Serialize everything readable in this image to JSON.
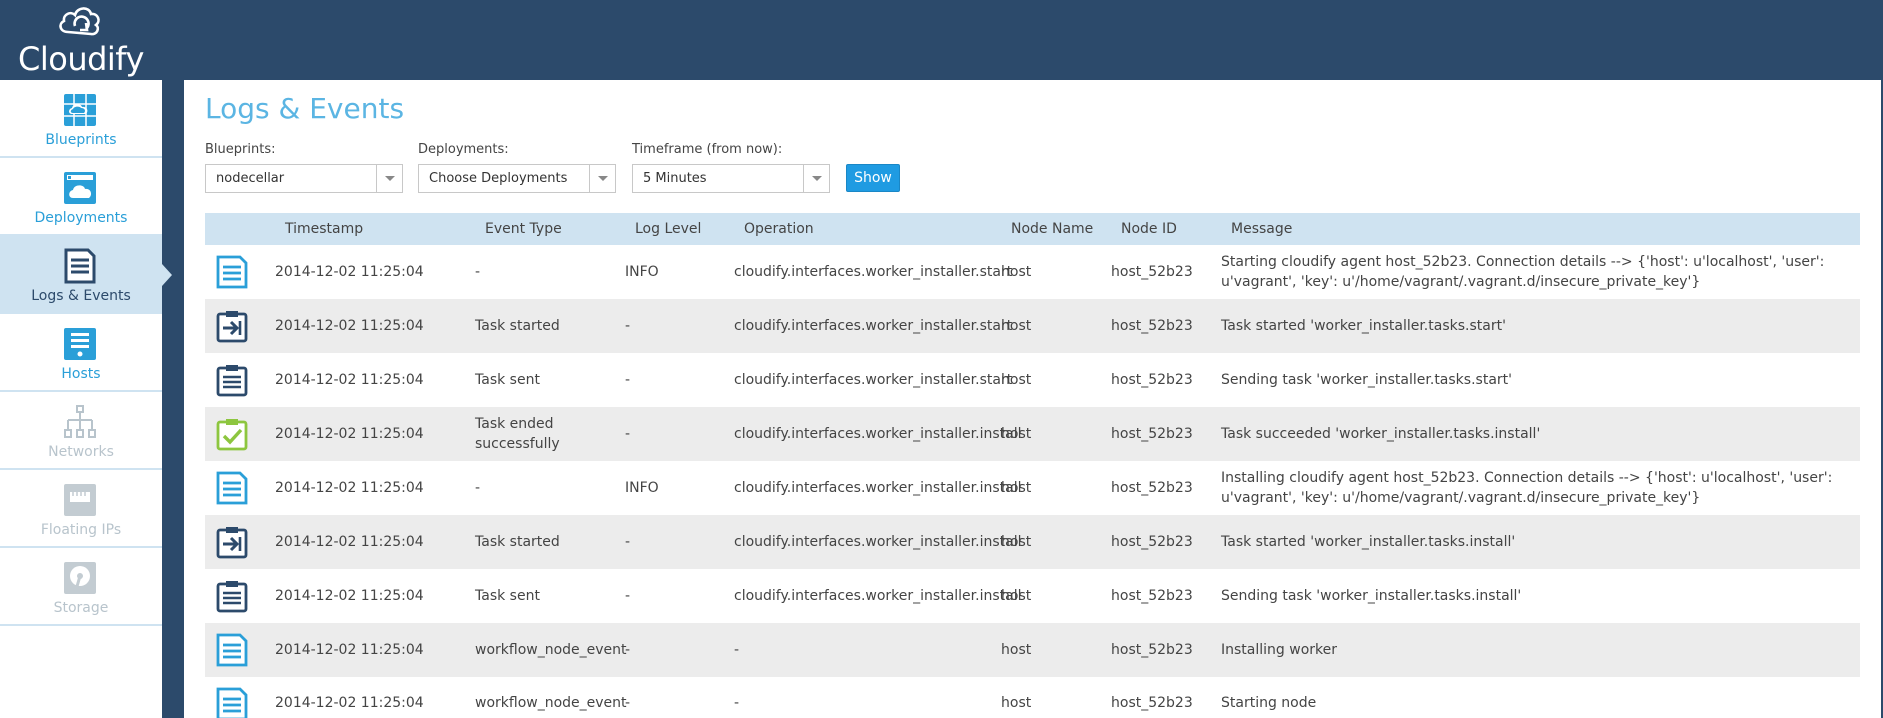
{
  "brand": {
    "name": "Cloudify"
  },
  "sidebar": {
    "items": [
      {
        "label": "Blueprints",
        "icon": "blueprints-icon",
        "state": "normal"
      },
      {
        "label": "Deployments",
        "icon": "deployments-icon",
        "state": "normal"
      },
      {
        "label": "Logs & Events",
        "icon": "logs-events-icon",
        "state": "active"
      },
      {
        "label": "Hosts",
        "icon": "hosts-icon",
        "state": "normal"
      },
      {
        "label": "Networks",
        "icon": "networks-icon",
        "state": "disabled"
      },
      {
        "label": "Floating IPs",
        "icon": "floating-ips-icon",
        "state": "disabled"
      },
      {
        "label": "Storage",
        "icon": "storage-icon",
        "state": "disabled"
      }
    ]
  },
  "page": {
    "title": "Logs & Events"
  },
  "filters": {
    "blueprints": {
      "label": "Blueprints:",
      "value": "nodecellar"
    },
    "deployments": {
      "label": "Deployments:",
      "value": "Choose Deployments"
    },
    "timeframe": {
      "label": "Timeframe (from now):",
      "value": "5 Minutes"
    },
    "show_label": "Show"
  },
  "table": {
    "columns": {
      "timestamp": "Timestamp",
      "event_type": "Event Type",
      "log_level": "Log Level",
      "operation": "Operation",
      "node_name": "Node Name",
      "node_id": "Node ID",
      "message": "Message"
    },
    "rows": [
      {
        "icon": "log-icon",
        "timestamp": "2014-12-02 11:25:04",
        "event_type": "-",
        "log_level": "INFO",
        "operation": "cloudify.interfaces.worker_installer.start",
        "node_name": "host",
        "node_id": "host_52b23",
        "message": "Starting cloudify agent host_52b23. Connection details --> {'host': u'localhost', 'user': u'vagrant', 'key': u'/home/vagrant/.vagrant.d/insecure_private_key'}"
      },
      {
        "icon": "task-started-icon",
        "timestamp": "2014-12-02 11:25:04",
        "event_type": "Task started",
        "log_level": "-",
        "operation": "cloudify.interfaces.worker_installer.start",
        "node_name": "host",
        "node_id": "host_52b23",
        "message": "Task started 'worker_installer.tasks.start'"
      },
      {
        "icon": "task-sent-icon",
        "timestamp": "2014-12-02 11:25:04",
        "event_type": "Task sent",
        "log_level": "-",
        "operation": "cloudify.interfaces.worker_installer.start",
        "node_name": "host",
        "node_id": "host_52b23",
        "message": "Sending task 'worker_installer.tasks.start'"
      },
      {
        "icon": "task-succeeded-icon",
        "timestamp": "2014-12-02 11:25:04",
        "event_type": "Task ended successfully",
        "log_level": "-",
        "operation": "cloudify.interfaces.worker_installer.install",
        "node_name": "host",
        "node_id": "host_52b23",
        "message": "Task succeeded 'worker_installer.tasks.install'"
      },
      {
        "icon": "log-icon",
        "timestamp": "2014-12-02 11:25:04",
        "event_type": "-",
        "log_level": "INFO",
        "operation": "cloudify.interfaces.worker_installer.install",
        "node_name": "host",
        "node_id": "host_52b23",
        "message": "Installing cloudify agent host_52b23. Connection details --> {'host': u'localhost', 'user': u'vagrant', 'key': u'/home/vagrant/.vagrant.d/insecure_private_key'}"
      },
      {
        "icon": "task-started-icon",
        "timestamp": "2014-12-02 11:25:04",
        "event_type": "Task started",
        "log_level": "-",
        "operation": "cloudify.interfaces.worker_installer.install",
        "node_name": "host",
        "node_id": "host_52b23",
        "message": "Task started 'worker_installer.tasks.install'"
      },
      {
        "icon": "task-sent-icon",
        "timestamp": "2014-12-02 11:25:04",
        "event_type": "Task sent",
        "log_level": "-",
        "operation": "cloudify.interfaces.worker_installer.install",
        "node_name": "host",
        "node_id": "host_52b23",
        "message": "Sending task 'worker_installer.tasks.install'"
      },
      {
        "icon": "log-icon",
        "timestamp": "2014-12-02 11:25:04",
        "event_type": "workflow_node_event",
        "log_level": "-",
        "operation": "-",
        "node_name": "host",
        "node_id": "host_52b23",
        "message": "Installing worker"
      },
      {
        "icon": "log-icon",
        "timestamp": "2014-12-02 11:25:04",
        "event_type": "workflow_node_event",
        "log_level": "-",
        "operation": "-",
        "node_name": "host",
        "node_id": "host_52b23",
        "message": "Starting node"
      }
    ]
  },
  "colors": {
    "header_bg": "#2c4a6b",
    "accent_blue": "#1f9be2",
    "title_blue": "#5bb5e3",
    "sidebar_active": "#cfe3f1",
    "icon_blue": "#2a9fd8",
    "icon_dark": "#2c4a6b",
    "icon_green": "#8dc63f"
  }
}
